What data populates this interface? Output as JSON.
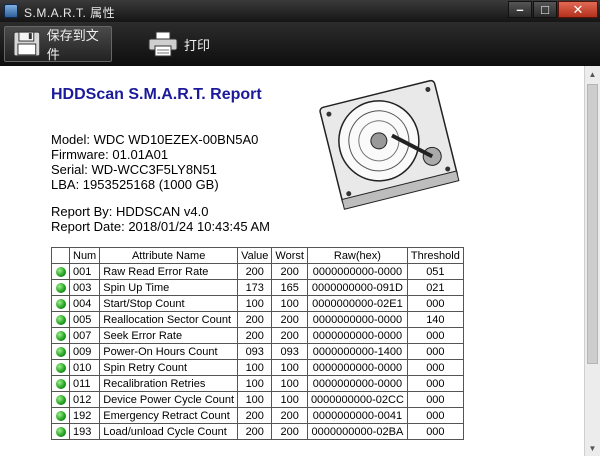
{
  "window": {
    "title": "S.M.A.R.T. 属性"
  },
  "toolbar": {
    "save_label": "保存到文件",
    "print_label": "打印"
  },
  "report": {
    "title": "HDDScan S.M.A.R.T. Report",
    "model": "Model: WDC WD10EZEX-00BN5A0",
    "firmware": "Firmware: 01.01A01",
    "serial": "Serial: WD-WCC3F5LY8N51",
    "lba": "LBA: 1953525168 (1000 GB)",
    "report_by": "Report By: HDDSCAN v4.0",
    "report_date": "Report Date: 2018/01/24 10:43:45 AM"
  },
  "table": {
    "headers": [
      "Num",
      "Attribute Name",
      "Value",
      "Worst",
      "Raw(hex)",
      "Threshold"
    ],
    "status_color": "#1f9c1f",
    "rows": [
      {
        "num": "001",
        "name": "Raw Read Error Rate",
        "value": "200",
        "worst": "200",
        "raw": "0000000000-0000",
        "threshold": "051"
      },
      {
        "num": "003",
        "name": "Spin Up Time",
        "value": "173",
        "worst": "165",
        "raw": "0000000000-091D",
        "threshold": "021"
      },
      {
        "num": "004",
        "name": "Start/Stop Count",
        "value": "100",
        "worst": "100",
        "raw": "0000000000-02E1",
        "threshold": "000"
      },
      {
        "num": "005",
        "name": "Reallocation Sector Count",
        "value": "200",
        "worst": "200",
        "raw": "0000000000-0000",
        "threshold": "140"
      },
      {
        "num": "007",
        "name": "Seek Error Rate",
        "value": "200",
        "worst": "200",
        "raw": "0000000000-0000",
        "threshold": "000"
      },
      {
        "num": "009",
        "name": "Power-On Hours Count",
        "value": "093",
        "worst": "093",
        "raw": "0000000000-1400",
        "threshold": "000"
      },
      {
        "num": "010",
        "name": "Spin Retry Count",
        "value": "100",
        "worst": "100",
        "raw": "0000000000-0000",
        "threshold": "000"
      },
      {
        "num": "011",
        "name": "Recalibration Retries",
        "value": "100",
        "worst": "100",
        "raw": "0000000000-0000",
        "threshold": "000"
      },
      {
        "num": "012",
        "name": "Device Power Cycle Count",
        "value": "100",
        "worst": "100",
        "raw": "0000000000-02CC",
        "threshold": "000"
      },
      {
        "num": "192",
        "name": "Emergency Retract Count",
        "value": "200",
        "worst": "200",
        "raw": "0000000000-0041",
        "threshold": "000"
      },
      {
        "num": "193",
        "name": "Load/unload Cycle Count",
        "value": "200",
        "worst": "200",
        "raw": "0000000000-02BA",
        "threshold": "000"
      }
    ]
  },
  "icons": {
    "app": "app-icon",
    "save": "floppy-disk-icon",
    "print": "printer-icon",
    "hdd": "hard-drive-icon",
    "status": "status-ok-icon"
  }
}
